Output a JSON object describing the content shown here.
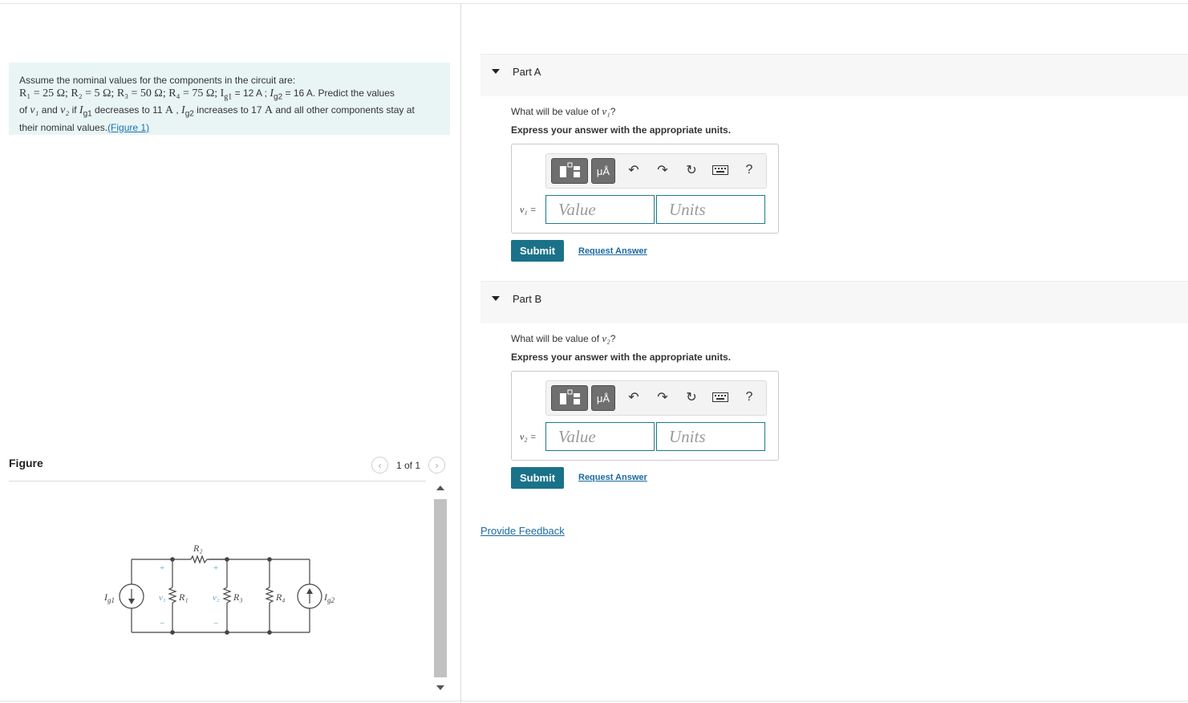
{
  "problem": {
    "line1": "Assume the nominal values for the components in the circuit are:",
    "values": "R₁ = 25 Ω; R₂ = 5 Ω; R₃ = 50 Ω; R₄ = 75 Ω; I",
    "ig1_sub": "g1",
    "ig1_val": " = 12 A ; ",
    "ig2_lead": "I",
    "ig2_sub": "g2",
    "ig2_val": " = 16 A",
    "predict": ". Predict the values",
    "line3a": "of ",
    "v1": "v₁",
    "and": " and ",
    "v2": "v₂",
    "if": " if ",
    "ig1b": "I",
    "ig1b_sub": "g1",
    "dec": " decreases to 11 ",
    "unitA": "A",
    "comma": " , ",
    "ig2b": "I",
    "ig2b_sub": "g2",
    "inc": " increases to 17 ",
    "unitA2": "A",
    "rest": " and all other components stay at",
    "line4": "their nominal values.",
    "figure_link": "(Figure 1)"
  },
  "figure": {
    "label": "Figure",
    "pager_text": "1 of 1",
    "labels": {
      "R2": "R₂",
      "R1": "R₁",
      "R3": "R₃",
      "R4": "R₄",
      "Ig1": "I",
      "Ig1_sub": "g1",
      "Ig2": "I",
      "Ig2_sub": "g2",
      "v1": "v₁",
      "v2": "v₂",
      "plus": "+",
      "minus": "−"
    }
  },
  "parts": [
    {
      "title": "Part A",
      "question_prefix": "What will be value of ",
      "question_var": "v₁",
      "question_suffix": "?",
      "instruction": "Express your answer with the appropriate units.",
      "answer_label": "v₁ =",
      "value_placeholder": "Value",
      "units_placeholder": "Units",
      "submit": "Submit",
      "request": "Request Answer"
    },
    {
      "title": "Part B",
      "question_prefix": "What will be value of ",
      "question_var": "v₂",
      "question_suffix": "?",
      "instruction": "Express your answer with the appropriate units.",
      "answer_label": "v₂ =",
      "value_placeholder": "Value",
      "units_placeholder": "Units",
      "submit": "Submit",
      "request": "Request Answer"
    }
  ],
  "toolbar": {
    "units_btn": "μÅ",
    "help": "?"
  },
  "feedback": "Provide Feedback",
  "icons": [
    "templates-icon",
    "units-icon",
    "undo-icon",
    "redo-icon",
    "reset-icon",
    "keyboard-icon",
    "help-icon"
  ]
}
